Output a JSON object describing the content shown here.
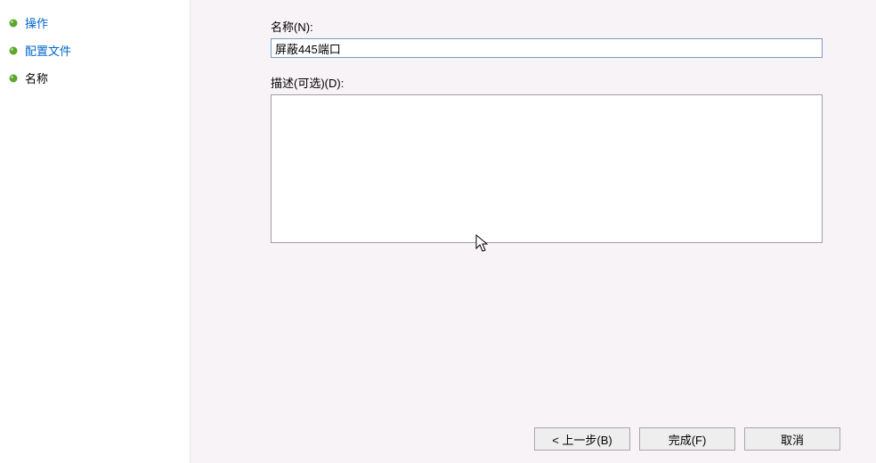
{
  "sidebar": {
    "items": [
      {
        "label": "操作",
        "type": "link"
      },
      {
        "label": "配置文件",
        "type": "link"
      },
      {
        "label": "名称",
        "type": "current"
      }
    ]
  },
  "main": {
    "name_label": "名称(N):",
    "name_value": "屏蔽445端口",
    "desc_label": "描述(可选)(D):",
    "desc_value": ""
  },
  "buttons": {
    "back": "< 上一步(B)",
    "finish": "完成(F)",
    "cancel": "取消"
  },
  "icons": {
    "bullet_color": "#5fa62f"
  }
}
